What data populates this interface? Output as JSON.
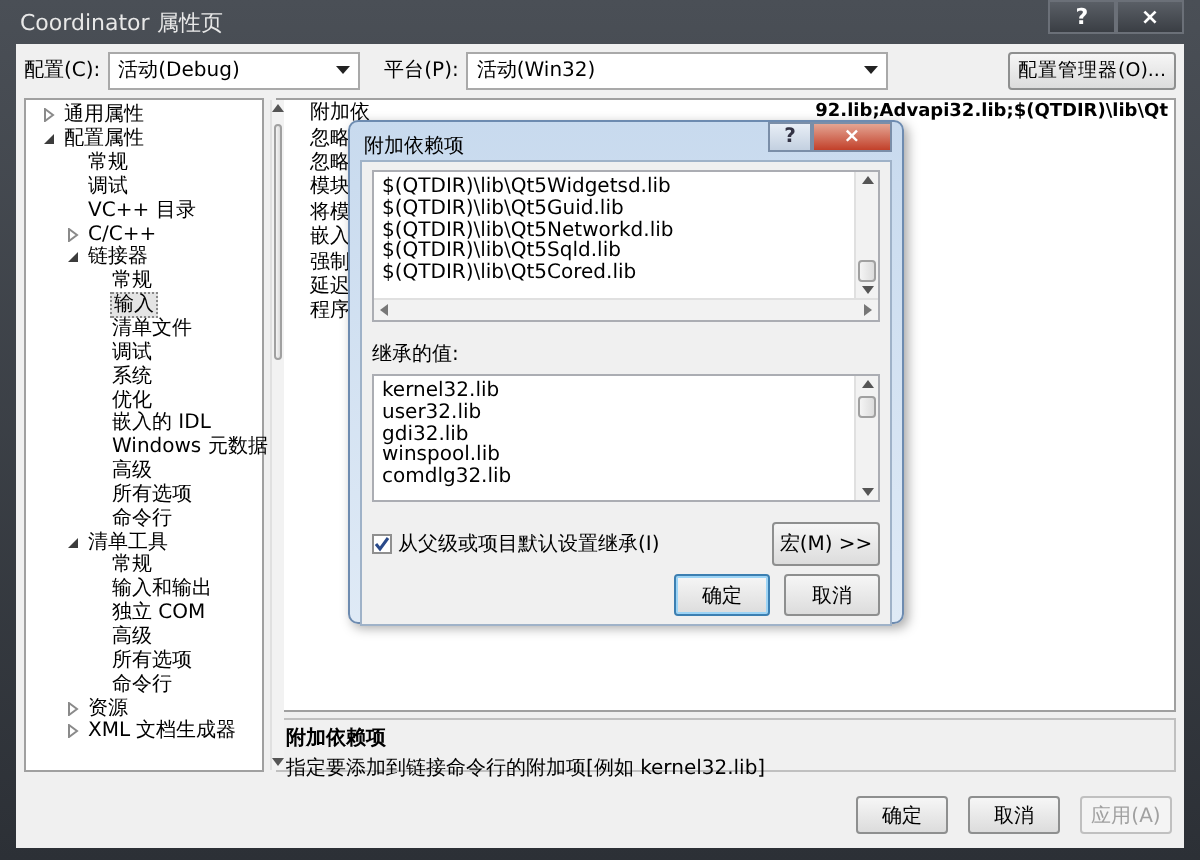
{
  "window": {
    "title": "Coordinator 属性页",
    "help_button": "?",
    "close_button": "×"
  },
  "toolbar": {
    "config_label": "配置(C):",
    "config_value": "活动(Debug)",
    "platform_label": "平台(P):",
    "platform_value": "活动(Win32)",
    "manager_button": "配置管理器(O)..."
  },
  "tree": [
    {
      "label": "通用属性",
      "expanded": false,
      "selected": false
    },
    {
      "label": "配置属性",
      "expanded": true,
      "selected": false,
      "children": [
        {
          "label": "常规",
          "selected": false
        },
        {
          "label": "调试",
          "selected": false
        },
        {
          "label": "VC++ 目录",
          "selected": false
        },
        {
          "label": "C/C++",
          "expanded": false,
          "selected": false
        },
        {
          "label": "链接器",
          "expanded": true,
          "selected": false,
          "children": [
            {
              "label": "常规",
              "selected": false
            },
            {
              "label": "输入",
              "selected": true
            },
            {
              "label": "清单文件",
              "selected": false
            },
            {
              "label": "调试",
              "selected": false
            },
            {
              "label": "系统",
              "selected": false
            },
            {
              "label": "优化",
              "selected": false
            },
            {
              "label": "嵌入的 IDL",
              "selected": false
            },
            {
              "label": "Windows 元数据",
              "selected": false
            },
            {
              "label": "高级",
              "selected": false
            },
            {
              "label": "所有选项",
              "selected": false
            },
            {
              "label": "命令行",
              "selected": false
            }
          ]
        },
        {
          "label": "清单工具",
          "expanded": true,
          "selected": false,
          "children": [
            {
              "label": "常规",
              "selected": false
            },
            {
              "label": "输入和输出",
              "selected": false
            },
            {
              "label": "独立 COM",
              "selected": false
            },
            {
              "label": "高级",
              "selected": false
            },
            {
              "label": "所有选项",
              "selected": false
            },
            {
              "label": "命令行",
              "selected": false
            }
          ]
        },
        {
          "label": "资源",
          "expanded": false,
          "selected": false
        },
        {
          "label": "XML 文档生成器",
          "expanded": false,
          "selected": false
        }
      ]
    }
  ],
  "properties": [
    {
      "name": "附加依",
      "value": "92.lib;Advapi32.lib;$(QTDIR)\\lib\\Qt"
    },
    {
      "name": "忽略"
    },
    {
      "name": "忽略"
    },
    {
      "name": "模块"
    },
    {
      "name": "将模"
    },
    {
      "name": "嵌入"
    },
    {
      "name": "强制"
    },
    {
      "name": "延迟"
    },
    {
      "name": "程序"
    }
  ],
  "description": {
    "title": "附加依赖项",
    "text": "指定要添加到链接命令行的附加项[例如 kernel32.lib]"
  },
  "buttons": [
    {
      "label": "确定",
      "disabled": false
    },
    {
      "label": "取消",
      "disabled": false
    },
    {
      "label": "应用(A)",
      "disabled": true
    }
  ],
  "dialog": {
    "title": "附加依赖项",
    "help_button": "?",
    "close_button": "×",
    "entries": [
      "$(QTDIR)\\lib\\Qt5Widgetsd.lib",
      "$(QTDIR)\\lib\\Qt5Guid.lib",
      "$(QTDIR)\\lib\\Qt5Networkd.lib",
      "$(QTDIR)\\lib\\Qt5Sqld.lib",
      "$(QTDIR)\\lib\\Qt5Cored.lib"
    ],
    "inherited_label": "继承的值:",
    "inherited": [
      "kernel32.lib",
      "user32.lib",
      "gdi32.lib",
      "winspool.lib",
      "comdlg32.lib"
    ],
    "inherit_checkbox": {
      "label": "从父级或项目默认设置继承(I)",
      "checked": true
    },
    "macro_button": "宏(M) >>",
    "buttons": [
      {
        "label": "确定",
        "default": true
      },
      {
        "label": "取消",
        "default": false
      }
    ]
  }
}
